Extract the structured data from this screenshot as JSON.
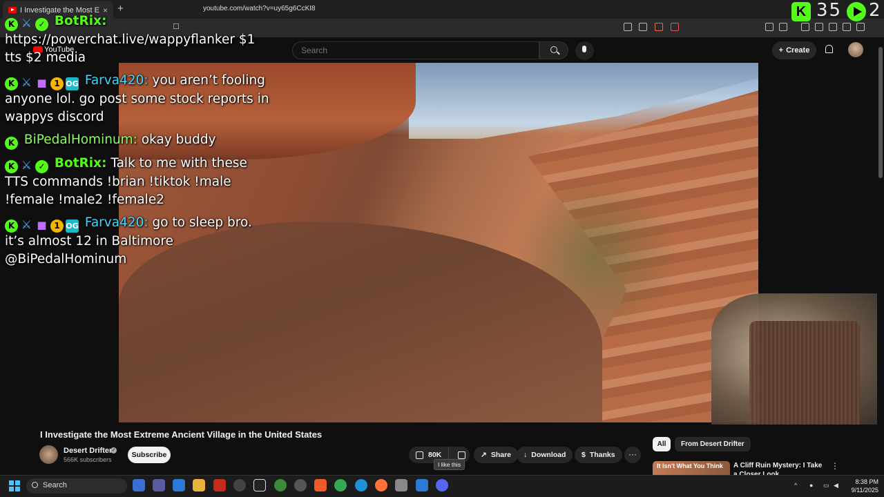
{
  "browser": {
    "tab_title": "I Investigate the Most Extreme",
    "tab_close": "×",
    "new_tab": "+",
    "url": "youtube.com/watch?v=uy65g6CcKI8"
  },
  "overlay_counter": {
    "count_left": "35",
    "count_right": "2"
  },
  "youtube": {
    "logo_text": "YouTube",
    "search_placeholder": "Search",
    "create_label": "Create"
  },
  "chat": {
    "messages": [
      {
        "user": "BotRix:",
        "text": "https://powerchat.live/wappyflanker $1 tts $2 media"
      },
      {
        "user": "Farva420:",
        "text": "you aren’t fooling anyone lol. go post some stock reports in wappys discord"
      },
      {
        "user": "BiPedalHominum:",
        "text": "okay buddy"
      },
      {
        "user": "BotRix:",
        "text": "Talk to me with these TTS commands !brian !tiktok !male !female !male2 !female2"
      },
      {
        "user": "Farva420:",
        "text": "go to sleep bro. it’s almost 12 in Baltimore @BiPedalHominum"
      }
    ]
  },
  "video": {
    "title": "I Investigate the Most Extreme Ancient Village in the United States",
    "channel_name": "Desert Drifter",
    "subscribers": "566K subscribers",
    "subscribe_label": "Subscribe",
    "like_count": "80K",
    "tooltip": "I like this",
    "share_label": "Share",
    "download_label": "Download",
    "thanks_label": "Thanks",
    "more_label": "···"
  },
  "sidebar": {
    "chip_all": "All",
    "chip_from": "From Desert Drifter",
    "rec_thumb_text": "It Isn't What You Think",
    "rec_title": "A Cliff Ruin Mystery: I Take a Closer Look"
  },
  "taskbar": {
    "search_label": "Search",
    "time": "8:38 PM",
    "date": "9/11/2025"
  },
  "colors": {
    "kick_green": "#53fc18",
    "youtube_red": "#ff0000",
    "background": "#0f0f0f"
  }
}
